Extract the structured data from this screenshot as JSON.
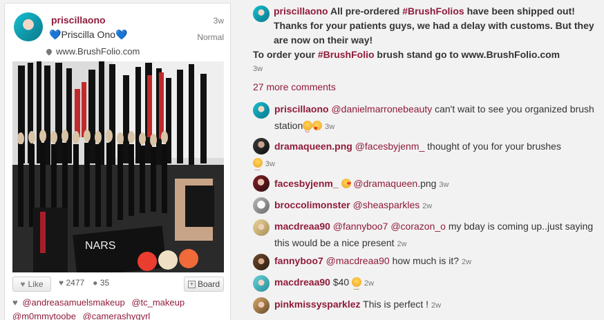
{
  "post": {
    "username": "priscillaono",
    "display_name": "Priscilla Ono",
    "time": "3w",
    "status": "Normal",
    "website": "www.BrushFolio.com",
    "like_label": "Like",
    "likes": "2477",
    "comments": "35",
    "board_label": "Board",
    "tags": [
      "@andreasamuelsmakeup",
      "@tc_makeup",
      "@m0mmytoobe",
      "@camerashygyrl"
    ]
  },
  "caption": {
    "username": "priscillaono",
    "text_1": "All pre-ordered",
    "hashtag_1": "#BrushFolios",
    "text_2": "have been shipped out! Thanks for your patients guys, we had a delay with customs. But they are now on their way!",
    "text_3": "To order your",
    "hashtag_2": "#BrushFolio",
    "text_4": "brush stand go to www.BrushFolio.com",
    "time": "3w"
  },
  "more_comments": "27 more comments",
  "comments": [
    {
      "user": "priscillaono",
      "mention": "@danielmarronebeauty",
      "text": "can't wait to see you organized brush station",
      "time": "3w"
    },
    {
      "user": "dramaqueen.png",
      "mention": "@facesbyjenm_",
      "text": "thought of you for your brushes",
      "time": "3w"
    },
    {
      "user": "facesbyjenm_",
      "mention": "@dramaqueen",
      "text": ".png",
      "time": "3w"
    },
    {
      "user": "broccolimonster",
      "mention": "@sheasparkles",
      "text": "",
      "time": "2w"
    },
    {
      "user": "macdreaa90",
      "mention": "@fannyboo7 @corazon_o",
      "text": "my bday is coming up..just saying this would be a nice present",
      "time": "2w"
    },
    {
      "user": "fannyboo7",
      "mention": "@macdreaa90",
      "text": "how much is it?",
      "time": "2w"
    },
    {
      "user": "macdreaa90",
      "mention": "",
      "text": "$40",
      "time": "2w"
    },
    {
      "user": "pinkmissysparklez",
      "mention": "",
      "text": "This is perfect !",
      "time": "2w"
    }
  ],
  "colors": {
    "accent": "#8f1b3a",
    "background": "#f2f2f2",
    "blue_heart": "#3b79ff"
  },
  "icons": {
    "like": "heart-icon",
    "likes_count": "heart-icon",
    "comments_count": "speech-bubble-icon",
    "board": "plus-icon",
    "location": "pin-icon"
  }
}
